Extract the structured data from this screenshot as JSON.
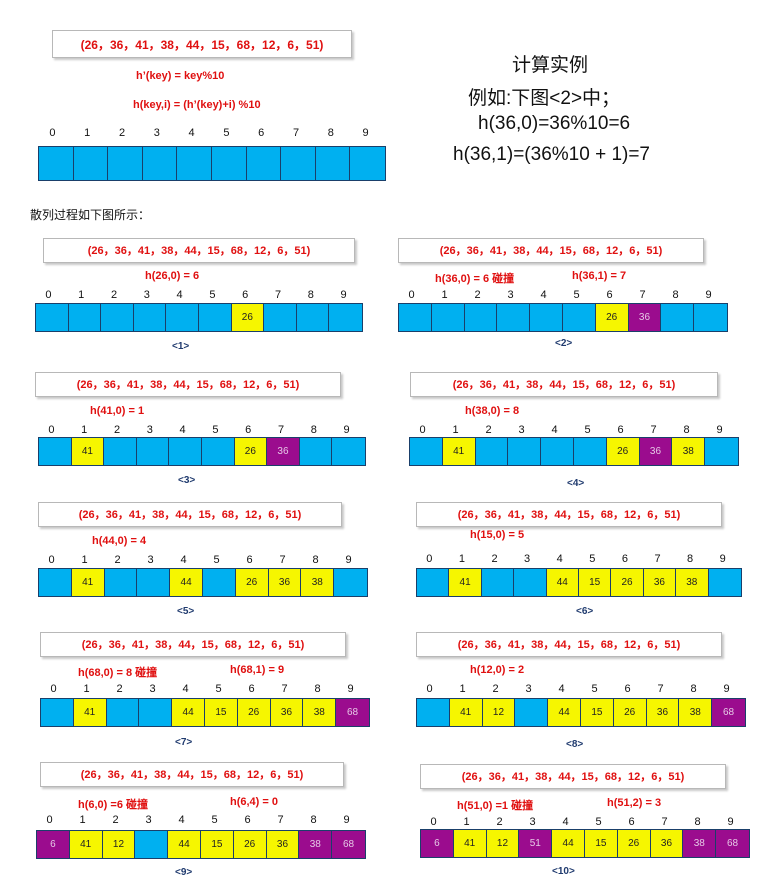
{
  "keys_text": "(26，36，41，38，44，15，68，12，6，51)",
  "indices": [
    "0",
    "1",
    "2",
    "3",
    "4",
    "5",
    "6",
    "7",
    "8",
    "9"
  ],
  "top": {
    "formula1": "h’(key) = key%10",
    "formula2": "h(key,i) = (h’(key)+i) %10"
  },
  "example": {
    "line1": "计算实例",
    "line2": "例如:下图<2>中；",
    "line3": "h(36,0)=36%10=6",
    "line4": "h(36,1)=(36%10 + 1)=7"
  },
  "caption": "散列过程如下图所示：",
  "steps": [
    {
      "label": "<1>",
      "annotations": [
        "h(26,0) = 6"
      ],
      "cells": [
        [
          "",
          ""
        ],
        [
          "",
          ""
        ],
        [
          "",
          ""
        ],
        [
          "",
          ""
        ],
        [
          "",
          ""
        ],
        [
          "",
          ""
        ],
        [
          "26",
          "y"
        ],
        [
          "",
          ""
        ],
        [
          "",
          ""
        ],
        [
          "",
          ""
        ]
      ]
    },
    {
      "label": "<2>",
      "annotations": [
        "h(36,0) = 6  碰撞",
        "h(36,1) = 7"
      ],
      "cells": [
        [
          "",
          ""
        ],
        [
          "",
          ""
        ],
        [
          "",
          ""
        ],
        [
          "",
          ""
        ],
        [
          "",
          ""
        ],
        [
          "",
          ""
        ],
        [
          "26",
          "y"
        ],
        [
          "36",
          "p"
        ],
        [
          "",
          ""
        ],
        [
          "",
          ""
        ]
      ]
    },
    {
      "label": "<3>",
      "annotations": [
        "h(41,0) = 1"
      ],
      "cells": [
        [
          "",
          ""
        ],
        [
          "41",
          "y"
        ],
        [
          "",
          ""
        ],
        [
          "",
          ""
        ],
        [
          "",
          ""
        ],
        [
          "",
          ""
        ],
        [
          "26",
          "y"
        ],
        [
          "36",
          "p"
        ],
        [
          "",
          ""
        ],
        [
          "",
          ""
        ]
      ]
    },
    {
      "label": "<4>",
      "annotations": [
        "h(38,0) = 8"
      ],
      "cells": [
        [
          "",
          ""
        ],
        [
          "41",
          "y"
        ],
        [
          "",
          ""
        ],
        [
          "",
          ""
        ],
        [
          "",
          ""
        ],
        [
          "",
          ""
        ],
        [
          "26",
          "y"
        ],
        [
          "36",
          "p"
        ],
        [
          "38",
          "y"
        ],
        [
          "",
          ""
        ]
      ]
    },
    {
      "label": "<5>",
      "annotations": [
        "h(44,0) = 4"
      ],
      "cells": [
        [
          "",
          ""
        ],
        [
          "41",
          "y"
        ],
        [
          "",
          ""
        ],
        [
          "",
          ""
        ],
        [
          "44",
          "y"
        ],
        [
          "",
          ""
        ],
        [
          "26",
          "y"
        ],
        [
          "36",
          "y"
        ],
        [
          "38",
          "y"
        ],
        [
          "",
          ""
        ]
      ]
    },
    {
      "label": "<6>",
      "annotations": [
        "h(15,0) = 5"
      ],
      "cells": [
        [
          "",
          ""
        ],
        [
          "41",
          "y"
        ],
        [
          "",
          ""
        ],
        [
          "",
          ""
        ],
        [
          "44",
          "y"
        ],
        [
          "15",
          "y"
        ],
        [
          "26",
          "y"
        ],
        [
          "36",
          "y"
        ],
        [
          "38",
          "y"
        ],
        [
          "",
          ""
        ]
      ]
    },
    {
      "label": "<7>",
      "annotations": [
        "h(68,0) = 8  碰撞",
        "h(68,1) = 9"
      ],
      "cells": [
        [
          "",
          ""
        ],
        [
          "41",
          "y"
        ],
        [
          "",
          ""
        ],
        [
          "",
          ""
        ],
        [
          "44",
          "y"
        ],
        [
          "15",
          "y"
        ],
        [
          "26",
          "y"
        ],
        [
          "36",
          "y"
        ],
        [
          "38",
          "y"
        ],
        [
          "68",
          "p"
        ]
      ]
    },
    {
      "label": "<8>",
      "annotations": [
        "h(12,0) = 2"
      ],
      "cells": [
        [
          "",
          ""
        ],
        [
          "41",
          "y"
        ],
        [
          "12",
          "y"
        ],
        [
          "",
          ""
        ],
        [
          "44",
          "y"
        ],
        [
          "15",
          "y"
        ],
        [
          "26",
          "y"
        ],
        [
          "36",
          "y"
        ],
        [
          "38",
          "y"
        ],
        [
          "68",
          "p"
        ]
      ]
    },
    {
      "label": "<9>",
      "annotations": [
        "h(6,0) =6  碰撞",
        "h(6,4) = 0"
      ],
      "cells": [
        [
          "6",
          "p"
        ],
        [
          "41",
          "y"
        ],
        [
          "12",
          "y"
        ],
        [
          "",
          ""
        ],
        [
          "44",
          "y"
        ],
        [
          "15",
          "y"
        ],
        [
          "26",
          "y"
        ],
        [
          "36",
          "y"
        ],
        [
          "38",
          "p"
        ],
        [
          "68",
          "p"
        ]
      ]
    },
    {
      "label": "<10>",
      "annotations": [
        "h(51,0) =1  碰撞",
        "h(51,2) = 3"
      ],
      "cells": [
        [
          "6",
          "p"
        ],
        [
          "41",
          "y"
        ],
        [
          "12",
          "y"
        ],
        [
          "51",
          "p"
        ],
        [
          "44",
          "y"
        ],
        [
          "15",
          "y"
        ],
        [
          "26",
          "y"
        ],
        [
          "36",
          "y"
        ],
        [
          "38",
          "p"
        ],
        [
          "68",
          "p"
        ]
      ]
    }
  ]
}
